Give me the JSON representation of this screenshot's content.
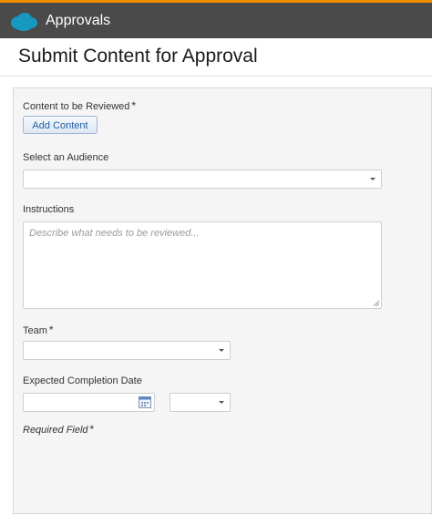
{
  "header": {
    "app_title": "Approvals",
    "logo_icon": "salesforce-cloud-logo",
    "accent_color": "#f18d00",
    "bar_color": "#4a4a4a"
  },
  "page": {
    "title": "Submit Content for Approval"
  },
  "form": {
    "content_label": "Content to be Reviewed",
    "required_marker": "*",
    "add_content_button": "Add Content",
    "audience_label": "Select an Audience",
    "audience_value": "",
    "instructions_label": "Instructions",
    "instructions_placeholder": "Describe what needs to be reviewed...",
    "team_label": "Team",
    "team_value": "",
    "completion_date_label": "Expected Completion Date",
    "completion_date_value": "",
    "completion_time_value": "",
    "required_field_note": "Required Field"
  }
}
